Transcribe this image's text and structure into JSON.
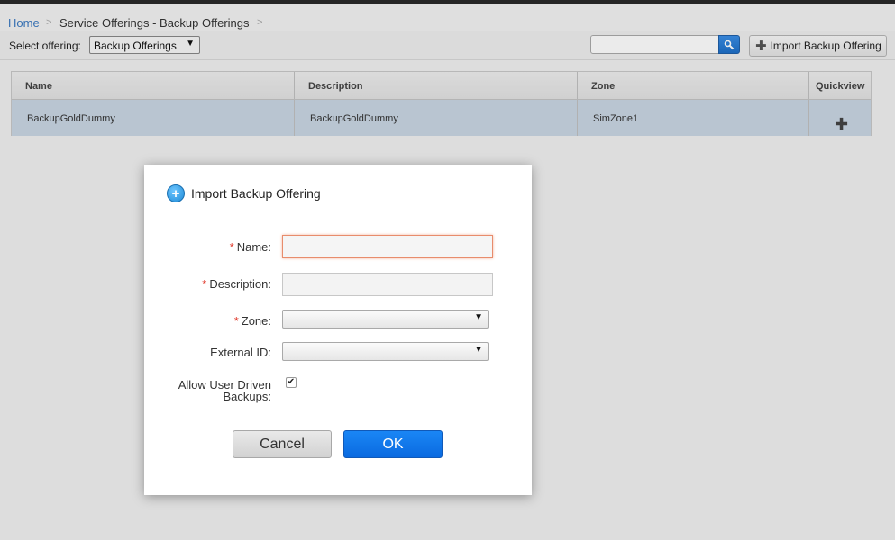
{
  "breadcrumb": {
    "home": "Home",
    "separator": ">",
    "current": "Service Offerings - Backup Offerings"
  },
  "toolbar": {
    "select_label": "Select offering:",
    "select_value": "Backup Offerings",
    "search_value": "",
    "import_button": "Import Backup Offering"
  },
  "table": {
    "columns": [
      "Name",
      "Description",
      "Zone",
      "Quickview"
    ],
    "rows": [
      {
        "name": "BackupGoldDummy",
        "description": "BackupGoldDummy",
        "zone": "SimZone1"
      }
    ]
  },
  "dialog": {
    "title": "Import Backup Offering",
    "fields": {
      "name": {
        "label": "Name:",
        "required": true,
        "value": ""
      },
      "description": {
        "label": "Description:",
        "required": true,
        "value": ""
      },
      "zone": {
        "label": "Zone:",
        "required": true,
        "value": ""
      },
      "external_id": {
        "label": "External ID:",
        "required": false,
        "value": ""
      },
      "allow_user_driven_line1": "Allow User Driven",
      "allow_user_driven_line2": "Backups:",
      "allow_user_driven_checked": true
    },
    "required_marker": "*",
    "cancel": "Cancel",
    "ok": "OK"
  },
  "colors": {
    "link": "#3a79c1",
    "primary_button": "#0a6ae0",
    "required": "#e0392b",
    "selected_row": "#c9d6e3"
  },
  "icons": [
    "search-icon",
    "plus-icon",
    "add-circle-icon",
    "checkmark-icon",
    "chevron-down-icon"
  ]
}
